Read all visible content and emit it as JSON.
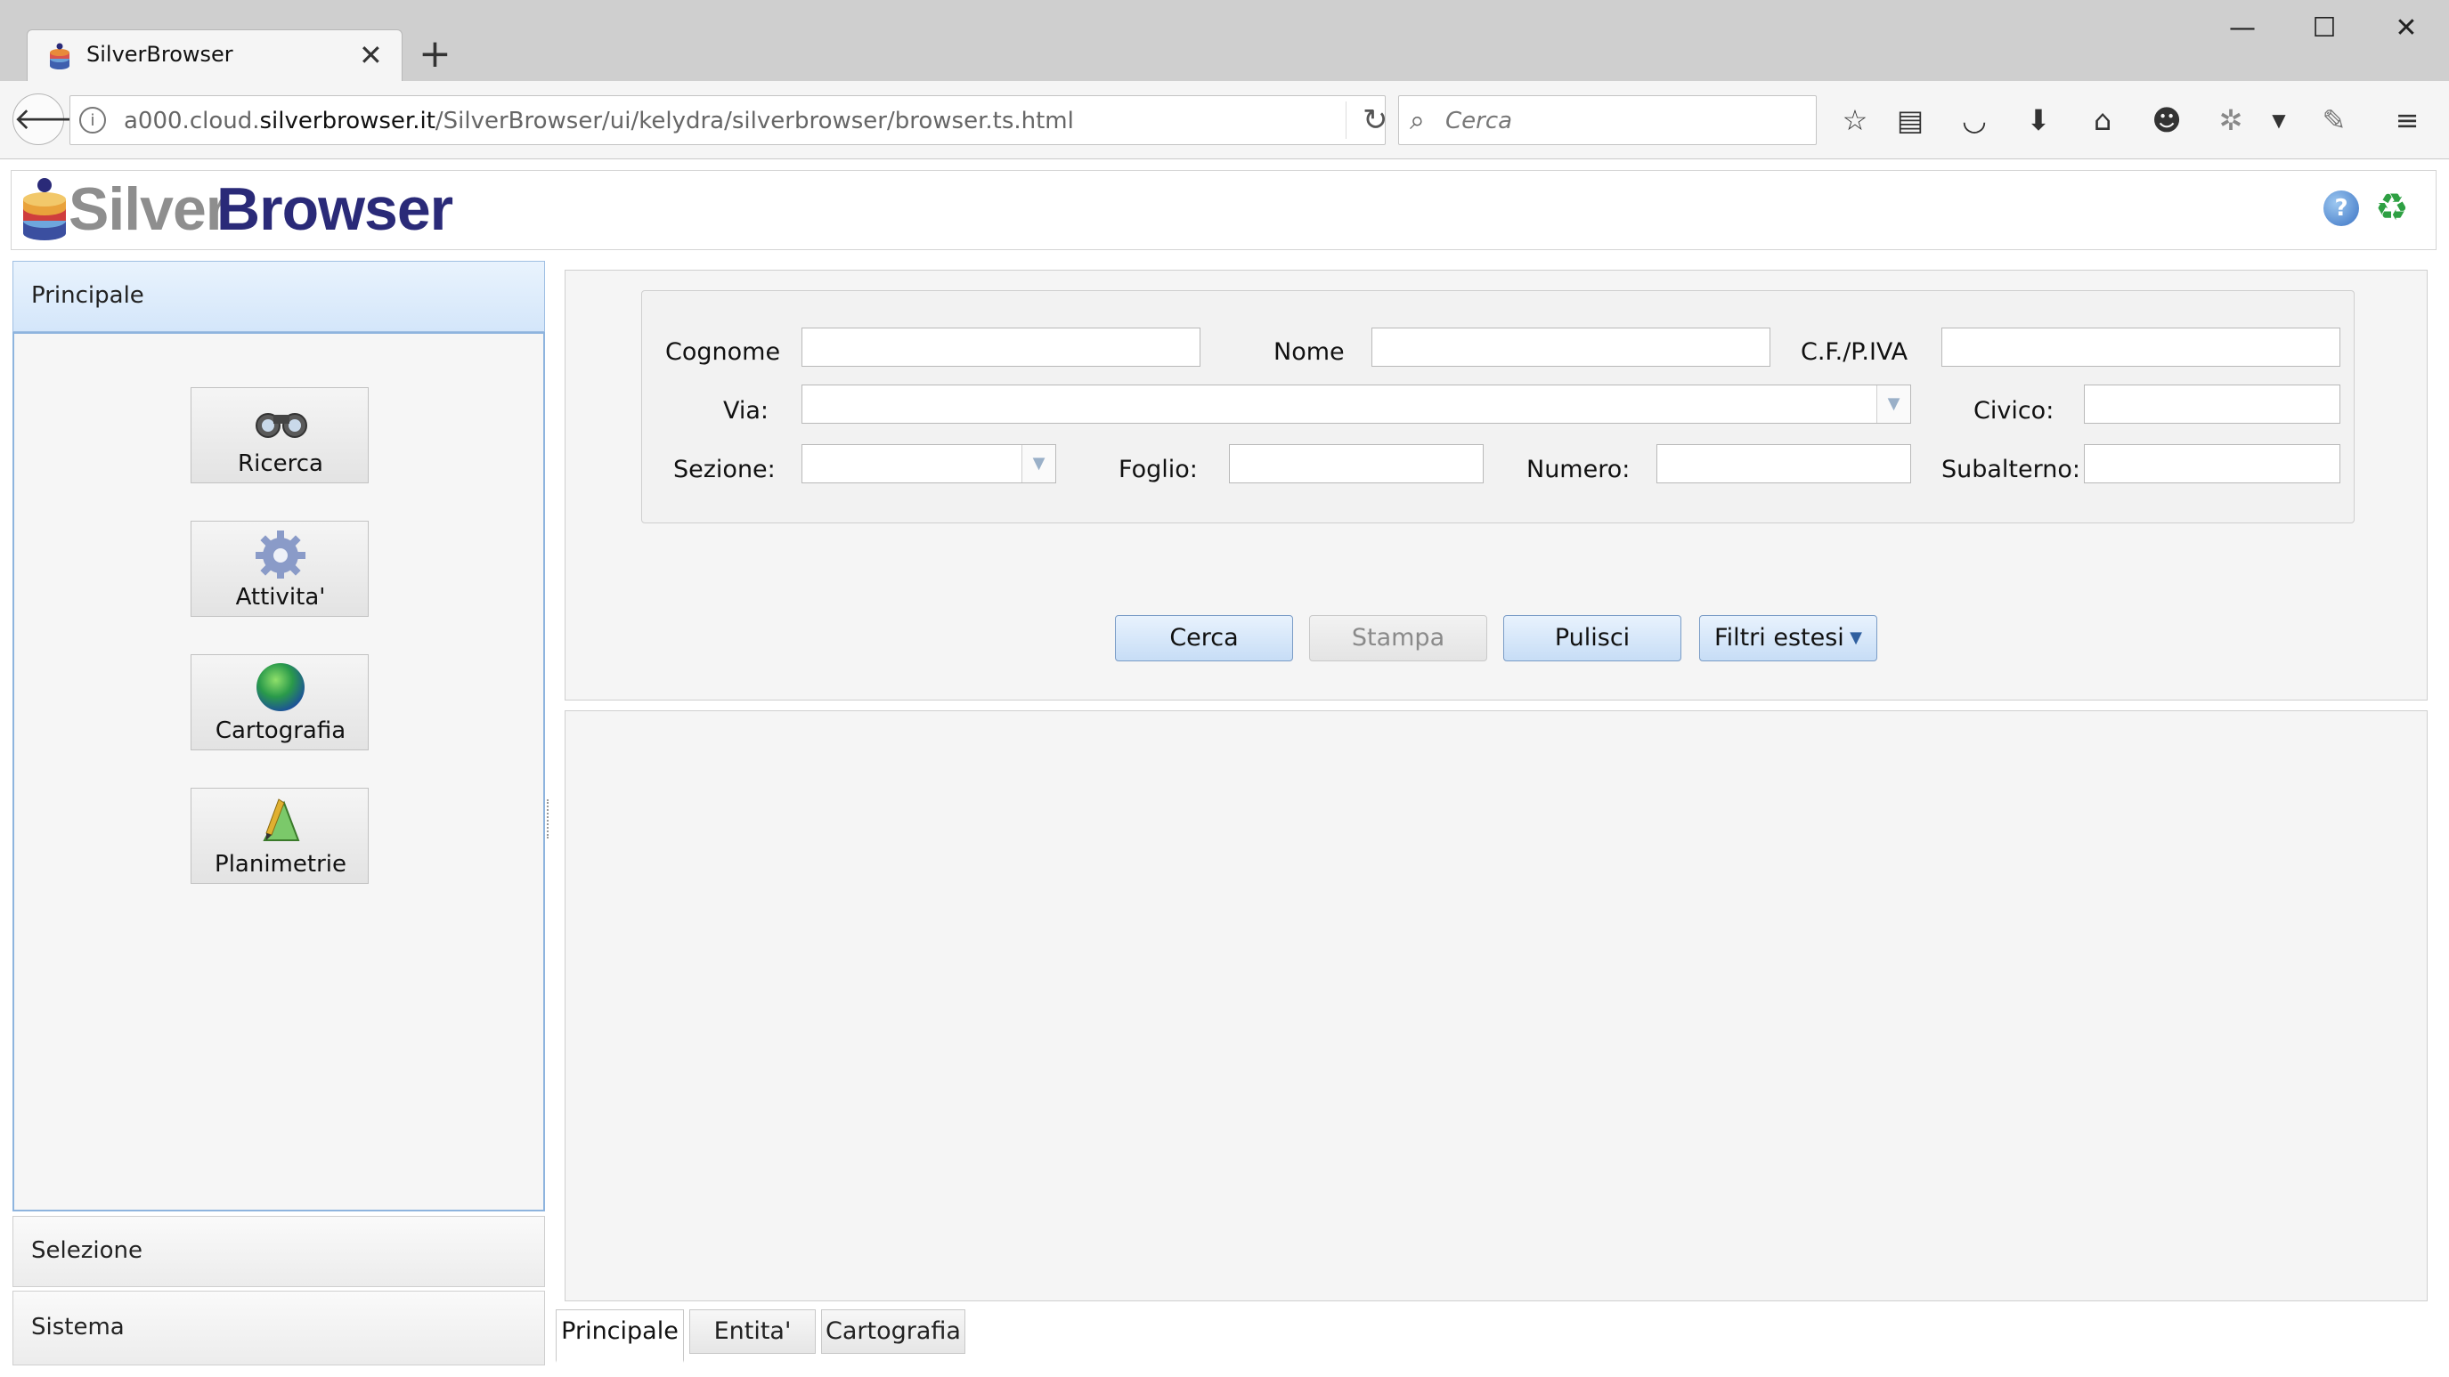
{
  "browser": {
    "tab_title": "SilverBrowser",
    "tab_close": "✕",
    "new_tab": "+",
    "window_controls": {
      "minimize": "—",
      "maximize": "☐",
      "close": "✕"
    },
    "url_prefix": "a000.cloud.",
    "url_domain": "silverbrowser.it",
    "url_path": "/SilverBrowser/ui/kelydra/silverbrowser/browser.ts.html",
    "search_placeholder": "Cerca",
    "toolbar_icons": [
      "star-icon",
      "reading-list-icon",
      "pocket-icon",
      "download-icon",
      "home-icon",
      "smiley-icon",
      "extension-icon",
      "dropdown-icon",
      "pin-icon",
      "menu-icon"
    ]
  },
  "app": {
    "logo_part1": "Silver",
    "logo_part2": "Browser",
    "help_icon": "?",
    "refresh_icon": "♻"
  },
  "sidebar": {
    "panels": [
      {
        "label": "Principale",
        "expanded": true
      },
      {
        "label": "Selezione",
        "expanded": false
      },
      {
        "label": "Sistema",
        "expanded": false
      }
    ],
    "tools": [
      {
        "label": "Ricerca",
        "icon": "binoculars-icon"
      },
      {
        "label": "Attivita'",
        "icon": "gear-icon"
      },
      {
        "label": "Cartografia",
        "icon": "globe-icon"
      },
      {
        "label": "Planimetrie",
        "icon": "drafting-icon"
      }
    ]
  },
  "form": {
    "cognome_label": "Cognome",
    "cognome_value": "",
    "nome_label": "Nome",
    "nome_value": "",
    "cf_label": "C.F./P.IVA",
    "cf_value": "",
    "via_label": "Via:",
    "via_value": "",
    "civico_label": "Civico:",
    "civico_value": "",
    "sezione_label": "Sezione:",
    "sezione_value": "",
    "foglio_label": "Foglio:",
    "foglio_value": "",
    "numero_label": "Numero:",
    "numero_value": "",
    "subalterno_label": "Subalterno:",
    "subalterno_value": ""
  },
  "actions": {
    "cerca": "Cerca",
    "stampa": "Stampa",
    "pulisci": "Pulisci",
    "filtri": "Filtri estesi"
  },
  "bottom_tabs": [
    {
      "label": "Principale",
      "active": true
    },
    {
      "label": "Entita'",
      "active": false
    },
    {
      "label": "Cartografia",
      "active": false
    }
  ],
  "colors": {
    "accent_border": "#8eb4de",
    "button_gradient_top": "#e8f2fd",
    "logo_dark": "#2a2a78",
    "logo_gray": "#8e8e8e"
  }
}
